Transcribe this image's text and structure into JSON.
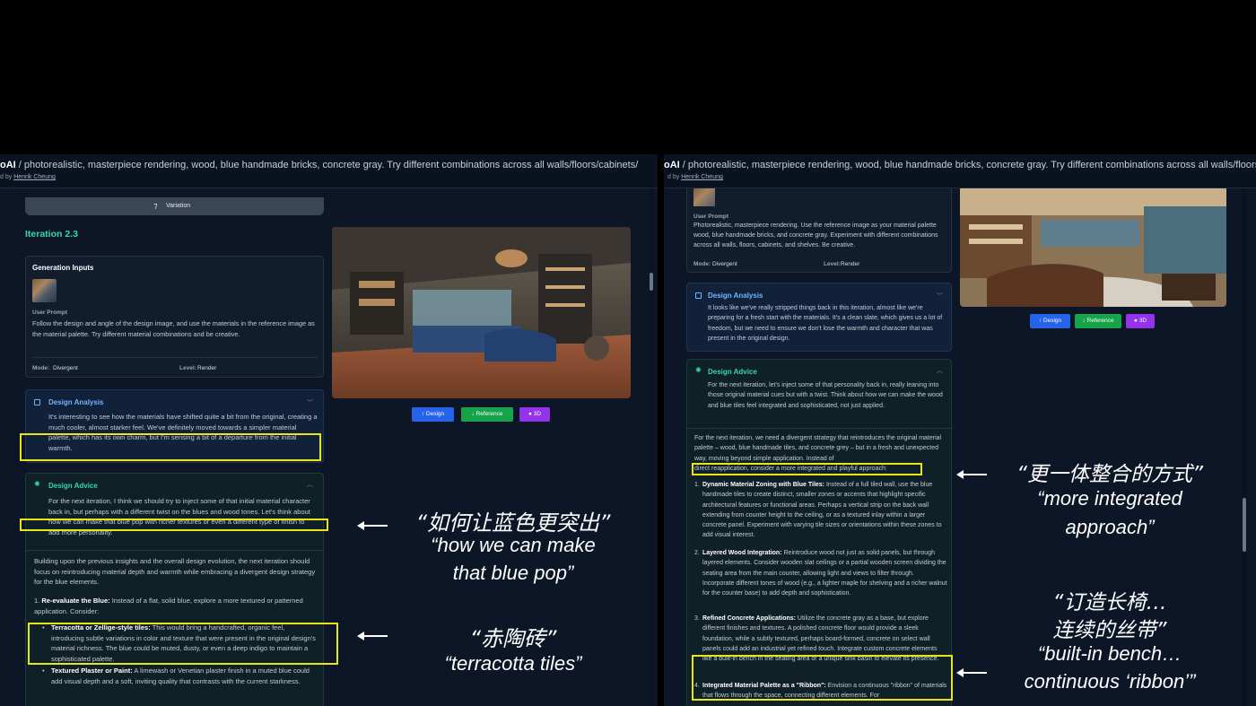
{
  "left": {
    "title_app": "oAI",
    "title_prompt": " / photorealistic, masterpiece rendering, wood, blue handmade bricks, concrete gray. Try different combinations across all walls/floors/cabinets/",
    "byline_prefix": "d by ",
    "byline_author": "Henrik Cheung",
    "variation_label": "Variation",
    "iteration_title": "Iteration 2.3",
    "generation_inputs_title": "Generation Inputs",
    "user_prompt_label": "User Prompt",
    "user_prompt": "Follow the design and angle of the design image, and use the materials in the reference image as the material palette. Try different material combinations and be creative.",
    "mode_label": "Mode:",
    "mode_value": "Divergent",
    "level_label": "Level:",
    "level_value": "Render",
    "design_analysis_title": "Design Analysis",
    "design_analysis_text": "It's interesting to see how the materials have shifted quite a bit from the original, creating a much cooler, almost starker feel. We've definitely moved towards a simpler material palette, which has its own charm, but I'm sensing a bit of a departure from the initial warmth.",
    "design_advice_title": "Design Advice",
    "design_advice_text": "For the next iteration, I think we should try to inject some of that initial material character back in, but perhaps with a different twist on the blues and wood tones. Let's think about how we can make that blue pop with richer textures or even a different type of finish to add more personality.",
    "building_text": "Building upon the previous insights and the overall design evolution, the next iteration should focus on reintroducing material depth and warmth while embracing a divergent design strategy for the blue elements.",
    "list_item_1_num": "1.",
    "list_item_1_bold": "Re-evaluate the Blue:",
    "list_item_1_text": " Instead of a flat, solid blue, explore a more textured or patterned application. Consider:",
    "bullet_1_bold": "Terracotta or Zellige-style tiles:",
    "bullet_1_text": " This would bring a handcrafted, organic feel, introducing subtle variations in color and texture that were present in the original design's material richness. The blue could be muted, dusty, or even a deep indigo to maintain a sophisticated palette.",
    "bullet_2_bold": "Textured Plaster or Paint:",
    "bullet_2_text": " A limewash or Venetian plaster finish in a muted blue could add visual depth and a soft, inviting quality that contrasts with the current starkness.",
    "btn_design": "Design",
    "btn_reference": "Reference",
    "btn_3d": "3D"
  },
  "right": {
    "title_app": "oAI",
    "title_prompt": " / photorealistic, masterpiece rendering, wood, blue handmade bricks, concrete gray. Try different combinations across all walls/floors/cabinets/s",
    "byline_prefix": "d by ",
    "byline_author": "Henrik Cheung",
    "user_prompt_label": "User Prompt",
    "user_prompt": "Photorealistic, masterpiece rendering. Use the reference image as your material palette wood, blue handmade bricks, and concrete gray. Experiment with different combinations across all walls, floors, cabinets, and shelves. Be creative.",
    "mode_label": "Mode:",
    "mode_value": "Divergent",
    "level_label": "Level:",
    "level_value": "Render",
    "design_analysis_title": "Design Analysis",
    "design_analysis_text": "It looks like we've really stripped things back in this iteration, almost like we're preparing for a fresh start with the materials. It's a clean slate, which gives us a lot of freedom, but we need to ensure we don't lose the warmth and character that was present in the original design.",
    "design_advice_title": "Design Advice",
    "design_advice_text": "For the next iteration, let's inject some of that personality back in, really leaning into those original material cues but with a twist. Think about how we can make the wood and blue tiles feel integrated and sophisticated, not just applied.",
    "strategy_text_a": "For the next iteration, we need a divergent strategy that reintroduces the original material palette – wood, blue handmade tiles, and concrete grey – but in a fresh and unexpected way, moving beyond simple application. Instead of",
    "strategy_text_b": "direct reapplication, consider a more integrated and playful approach:",
    "item1_num": "1.",
    "item1_bold": "Dynamic Material Zoning with Blue Tiles:",
    "item1_text": " Instead of a full tiled wall, use the blue handmade tiles to create distinct, smaller zones or accents that highlight specific architectural features or functional areas. Perhaps a vertical strip on the back wall extending from counter height to the ceiling, or as a textured inlay within a larger concrete panel. Experiment with varying tile sizes or orientations within these zones to add visual interest.",
    "item2_num": "2.",
    "item2_bold": "Layered Wood Integration:",
    "item2_text": " Reintroduce wood not just as solid panels, but through layered elements. Consider wooden slat ceilings or a partial wooden screen dividing the seating area from the main counter, allowing light and views to filter through. Incorporate different tones of wood (e.g., a lighter maple for shelving and a richer walnut for the counter base) to add depth and sophistication.",
    "item3_num": "3.",
    "item3_bold": "Refined Concrete Applications:",
    "item3_text": " Utilize the concrete gray as a base, but explore different finishes and textures. A polished concrete floor would provide a sleek foundation, while a subtly textured, perhaps board-formed, concrete on select wall panels could add an industrial yet refined touch.",
    "item3_text_b": "Integrate custom concrete elements like a built-in bench in the seating area or a unique sink basin to elevate its presence.",
    "item4_num": "4.",
    "item4_bold": "Integrated Material Palette as a \"Ribbon\":",
    "item4_text": " Envision a continuous \"ribbon\" of materials that flows through the space, connecting different elements. For",
    "btn_design": "Design",
    "btn_reference": "Reference",
    "btn_3d": "3D"
  },
  "annotations": {
    "a1_cn": "“如何让蓝色更突出”",
    "a1_en1": "“how we can make",
    "a1_en2": "that blue pop”",
    "a2_cn": "“赤陶砖”",
    "a2_en": "“terracotta tiles”",
    "a3_cn": "“更一体整合的方式”",
    "a3_en1": "“more integrated",
    "a3_en2": "approach”",
    "a4_cn1": "“订造长椅…",
    "a4_cn2": "连续的丝带”",
    "a4_en1": "“built-in bench…",
    "a4_en2": "continuous ‘ribbon’”"
  },
  "colors": {
    "accent_blue": "#2563eb",
    "accent_green": "#16a34a",
    "accent_purple": "#9333ea",
    "highlight_yellow": "#e6e619",
    "teal_heading": "#35d6b3"
  }
}
